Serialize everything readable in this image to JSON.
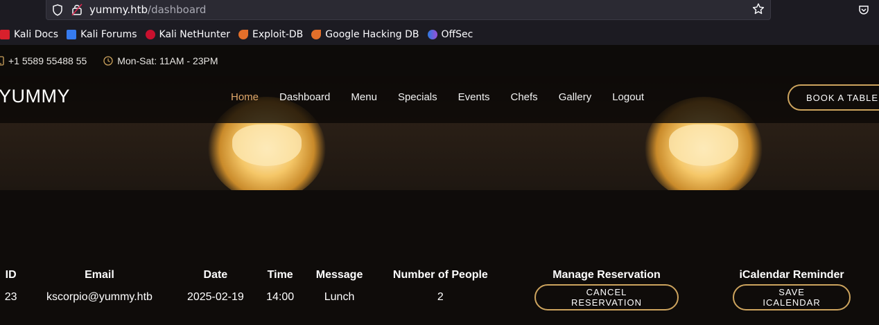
{
  "browser": {
    "url_host": "yummy.htb",
    "url_path": "/dashboard",
    "bookmarks": [
      {
        "label": "Kali Docs",
        "icon": "kali-docs-icon",
        "color": "#d8202c"
      },
      {
        "label": "Kali Forums",
        "icon": "kali-forums-icon",
        "color": "#367bf0"
      },
      {
        "label": "Kali NetHunter",
        "icon": "kali-nethunter-icon",
        "color": "#c8102e"
      },
      {
        "label": "Exploit-DB",
        "icon": "exploit-db-icon",
        "color": "#e36f2a"
      },
      {
        "label": "Google Hacking DB",
        "icon": "ghdb-icon",
        "color": "#e36f2a"
      },
      {
        "label": "OffSec",
        "icon": "offsec-icon",
        "color": "#5b6ee1"
      }
    ]
  },
  "topbar": {
    "phone": "+1 5589 55488 55",
    "hours": "Mon-Sat: 11AM - 23PM"
  },
  "header": {
    "brand": "YUMMY",
    "nav": [
      "Home",
      "Dashboard",
      "Menu",
      "Specials",
      "Events",
      "Chefs",
      "Gallery",
      "Logout"
    ],
    "active_nav": "Home",
    "book_button": "BOOK A TABLE"
  },
  "table": {
    "headers": [
      "ID",
      "Email",
      "Date",
      "Time",
      "Message",
      "Number of People",
      "Manage Reservation",
      "iCalendar Reminder"
    ],
    "rows": [
      {
        "id": "23",
        "email": "kscorpio@yummy.htb",
        "date": "2025-02-19",
        "time": "14:00",
        "message": "Lunch",
        "people": "2",
        "cancel_label": "CANCEL RESERVATION",
        "ical_label": "SAVE ICALENDAR"
      }
    ]
  },
  "colors": {
    "accent": "#cda45e",
    "active_nav": "#e0a76a",
    "background": "#0f0c0a"
  }
}
